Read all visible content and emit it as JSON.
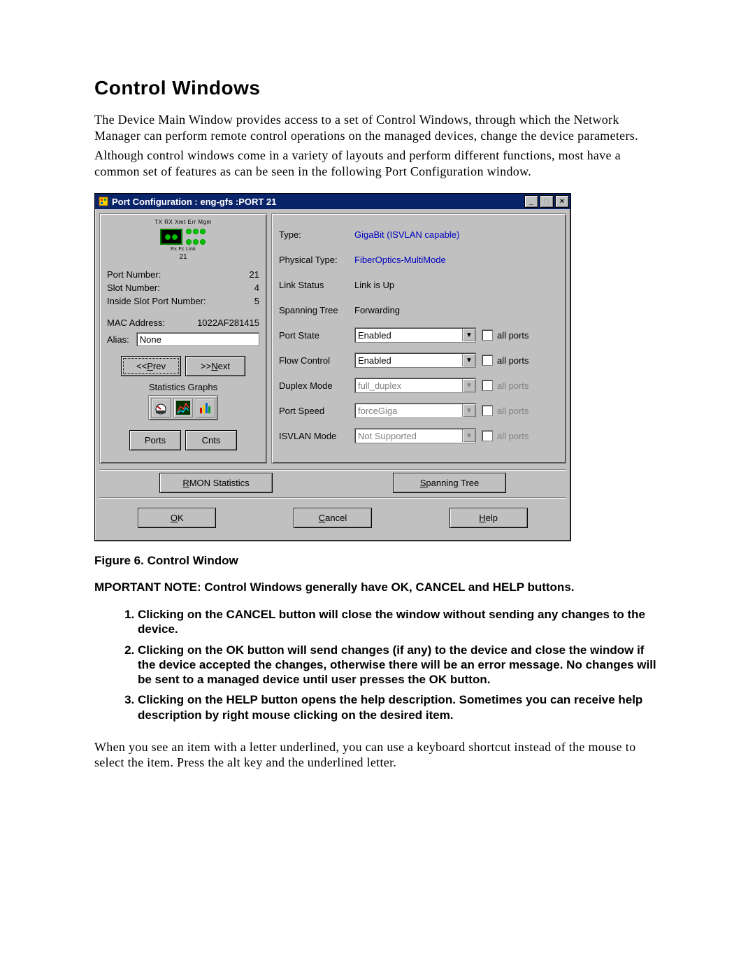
{
  "heading": "Control Windows",
  "para1": "The Device Main Window provides access to a set of Control Windows, through which the Network Manager can perform remote control operations on the managed devices, change the device parameters.",
  "para2": "Although control windows come in a variety of layouts and perform different functions, most have a common set of features as can be seen in the following Port Configuration window.",
  "figcaption": "Figure 6. Control Window",
  "important": "MPORTANT NOTE: Control Windows generally have OK, CANCEL and HELP buttons.",
  "notes": [
    "Clicking on the CANCEL button will close the window without sending any changes to the device.",
    "Clicking on the OK button will send changes (if any) to the device and close the window if the device accepted the changes, otherwise there will be an error message. No changes will be sent to a managed device until user presses the OK button.",
    "Clicking on the HELP button opens the help description. Sometimes you can receive help description by right mouse clicking on the desired item."
  ],
  "para3": "When you see an item with a letter underlined, you can use a keyboard shortcut instead of the mouse to select the item. Press the alt key and the underlined letter.",
  "dialog": {
    "title": "Port Configuration : eng-gfs :PORT 21",
    "left": {
      "diag_top_labels": "TX  RX  Xmt Err Mgm",
      "diag_sub_labels": "Rx  Fc  Link",
      "diag_port": "21",
      "port_number_lbl": "Port Number:",
      "port_number_val": "21",
      "slot_number_lbl": "Slot Number:",
      "slot_number_val": "4",
      "inside_slot_lbl": "Inside Slot Port Number:",
      "inside_slot_val": "5",
      "mac_lbl": "MAC Address:",
      "mac_val": "1022AF281415",
      "alias_lbl": "Alias:",
      "alias_val": "None",
      "prev_btn": "<< Prev",
      "prev_ul": "P",
      "next_btn": ">> Next",
      "next_ul": "N",
      "stats_label": "Statistics Graphs",
      "ports_btn": "Ports",
      "cnts_btn": "Cnts",
      "rmon_btn": "RMON Statistics",
      "rmon_ul": "R"
    },
    "right": {
      "rows": [
        {
          "lbl": "Type:",
          "val": "GigaBit (ISVLAN capable)",
          "kind": "link"
        },
        {
          "lbl": "Physical Type:",
          "val": "FiberOptics-MultiMode",
          "kind": "link"
        },
        {
          "lbl": "Link Status",
          "val": "Link is Up",
          "kind": "plain"
        },
        {
          "lbl": "Spanning Tree",
          "val": "Forwarding",
          "kind": "plain"
        },
        {
          "lbl": "Port State",
          "val": "Enabled",
          "kind": "combo",
          "enabled": true
        },
        {
          "lbl": "Flow Control",
          "val": "Enabled",
          "kind": "combo",
          "enabled": true
        },
        {
          "lbl": "Duplex Mode",
          "val": "full_duplex",
          "kind": "combo",
          "enabled": false
        },
        {
          "lbl": "Port Speed",
          "val": "forceGiga",
          "kind": "combo",
          "enabled": false
        },
        {
          "lbl": "ISVLAN Mode",
          "val": "Not Supported",
          "kind": "combo",
          "enabled": false
        }
      ],
      "allports": "all ports",
      "spanning_btn": "Spanning Tree",
      "spanning_ul": "S"
    },
    "bottom": {
      "ok": "OK",
      "ok_ul": "O",
      "cancel": "Cancel",
      "cancel_ul": "C",
      "help": "Help",
      "help_ul": "H"
    }
  }
}
